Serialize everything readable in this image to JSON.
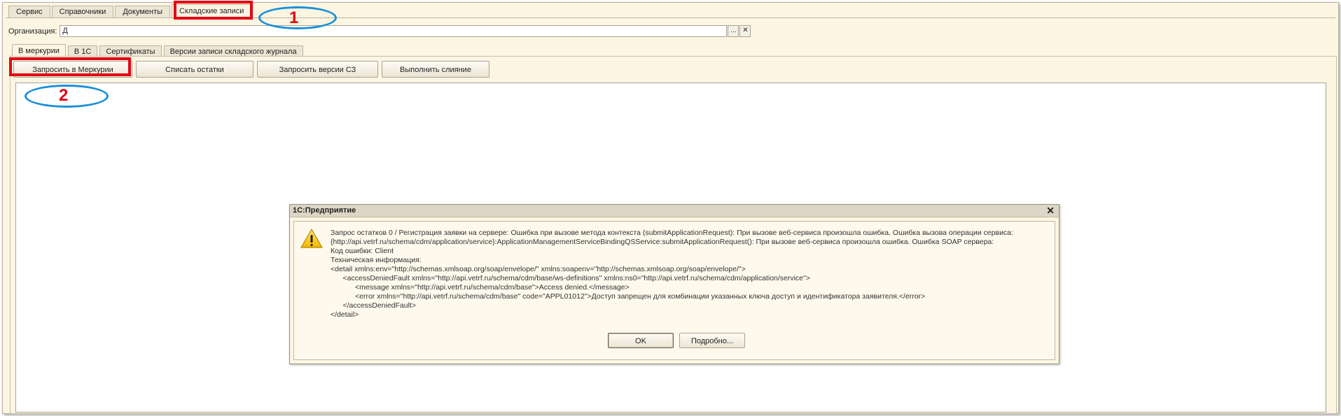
{
  "top_tabs": [
    "Сервис",
    "Справочники",
    "Документы",
    "Складские записи"
  ],
  "org": {
    "label": "Организация:",
    "value": "Д",
    "select_label": "...",
    "clear_label": "✕"
  },
  "inner_tabs": [
    "В меркурии",
    "В 1С",
    "Сертификаты",
    "Версии записи складского журнала"
  ],
  "buttons": [
    "Запросить в Меркурии",
    "Списать остатки",
    "Запросить версии СЗ",
    "Выполнить слияние"
  ],
  "annotations": {
    "n1": "1",
    "n2": "2"
  },
  "dialog": {
    "title": "1С:Предприятие",
    "close_label": "✕",
    "lines": [
      "Запрос остатков 0 / Регистрация заявки на сервере: Ошибка при вызове метода контекста (submitApplicationRequest): При вызове веб-сервиса произошла ошибка. Ошибка вызова операции сервиса:",
      "{http://api.vetrf.ru/schema/cdm/application/service}:ApplicationManagementServiceBindingQSService:submitApplicationRequest(): При вызове веб-сервиса произошла ошибка. Ошибка SOAP сервера:",
      "Код ошибки: Client",
      "Техническая информация:",
      "<detail xmlns:env=\"http://schemas.xmlsoap.org/soap/envelope/\" xmlns:soapenv=\"http://schemas.xmlsoap.org/soap/envelope/\">",
      "      <accessDeniedFault xmlns=\"http://api.vetrf.ru/schema/cdm/base/ws-definitions\" xmlns:ns0=\"http://api.vetrf.ru/schema/cdm/application/service\">",
      "            <message xmlns=\"http://api.vetrf.ru/schema/cdm/base\">Access denied.</message>",
      "            <error xmlns=\"http://api.vetrf.ru/schema/cdm/base\" code=\"APPL01012\">Доступ запрещен для комбинации указанных ключа доступ и идентификатора заявителя.</error>",
      "      </accessDeniedFault>",
      "</detail>"
    ],
    "ok_label": "OK",
    "details_label": "Подробно..."
  },
  "colors": {
    "accent_red": "#e30613",
    "accent_blue": "#1b8fd8",
    "background": "#fbf5e2"
  }
}
